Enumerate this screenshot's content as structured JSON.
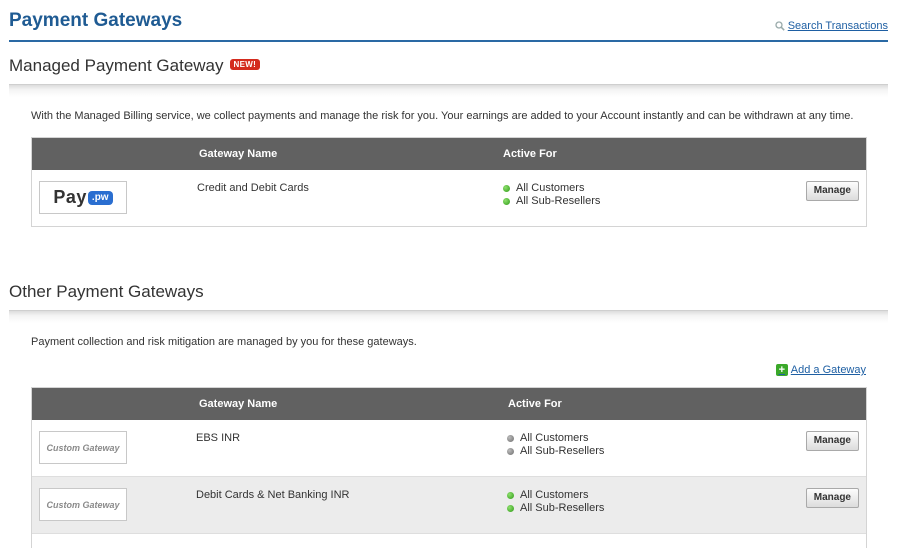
{
  "page": {
    "title": "Payment Gateways",
    "search_link": "Search Transactions"
  },
  "managed": {
    "title": "Managed Payment Gateway",
    "badge": "NEW!",
    "description": "With the Managed Billing service, we collect payments and manage the risk for you. Your earnings are added to your Account instantly and can be withdrawn at any time.",
    "columns": {
      "name": "Gateway Name",
      "active": "Active For"
    },
    "rows": [
      {
        "logo_text": "Pay",
        "logo_badge": ".pw",
        "name": "Credit and Debit Cards",
        "active": [
          {
            "label": "All Customers",
            "status": "green"
          },
          {
            "label": "All Sub-Resellers",
            "status": "green"
          }
        ],
        "button": "Manage"
      }
    ]
  },
  "other": {
    "title": "Other Payment Gateways",
    "description": "Payment collection and risk mitigation are managed by you for these gateways.",
    "add_link": "Add a Gateway",
    "columns": {
      "name": "Gateway Name",
      "active": "Active For"
    },
    "rows": [
      {
        "logo": "Custom Gateway",
        "name": "EBS INR",
        "active": [
          {
            "label": "All Customers",
            "status": "gray"
          },
          {
            "label": "All Sub-Resellers",
            "status": "gray"
          }
        ],
        "button": "Manage"
      },
      {
        "logo": "Custom Gateway",
        "name": "Debit Cards & Net Banking INR",
        "active": [
          {
            "label": "All Customers",
            "status": "green"
          },
          {
            "label": "All Sub-Resellers",
            "status": "green"
          }
        ],
        "button": "Manage"
      }
    ]
  },
  "colors": {
    "link": "#1e5fa3",
    "title": "#1f5b93",
    "header_bg": "#616161",
    "active_dot": "#2e9a16",
    "inactive_dot": "#6d6d6d",
    "badge": "#d42b1e"
  }
}
